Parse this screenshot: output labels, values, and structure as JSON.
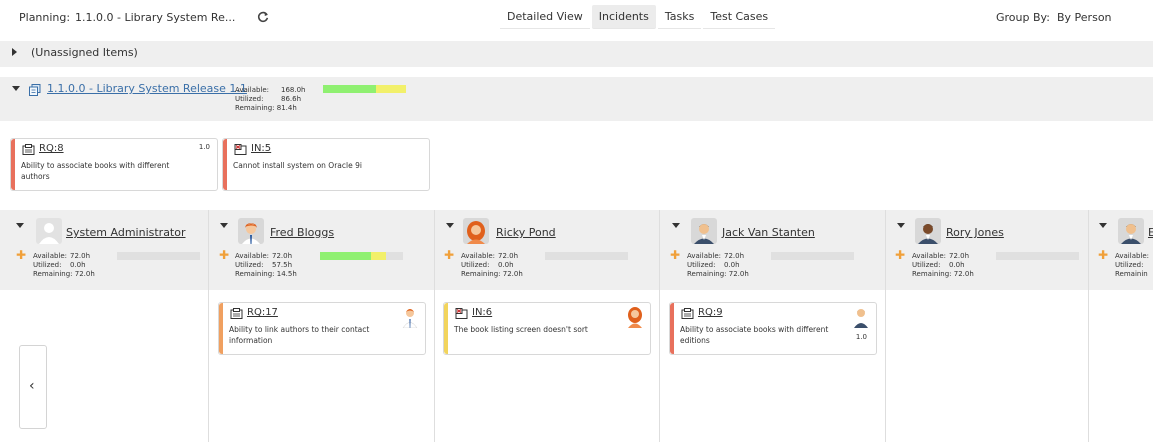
{
  "toolbar": {
    "planning_label": "Planning:",
    "planning_value": "1.1.0.0 - Library System Re...",
    "tabs": [
      "Detailed View",
      "Incidents",
      "Tasks",
      "Test Cases"
    ],
    "active_tab": "Incidents",
    "groupby_label": "Group By:",
    "groupby_value": "By Person"
  },
  "unassigned": {
    "label": "(Unassigned Items)"
  },
  "release": {
    "name": "1.1.0.0 - Library System Release 1.1",
    "available": "Available:",
    "available_val": "168.0h",
    "utilized": "Utilized:",
    "utilized_val": "86.6h",
    "remaining": "Remaining:",
    "remaining_val": "81.4h",
    "bar_green": 0.64,
    "bar_yellow": 0.36
  },
  "release_cards": [
    {
      "id": "RQ:8",
      "desc_1": "Ability to associate books with different",
      "desc_2": "authors",
      "estimate": "1.0",
      "stripe": "#e8705c",
      "icon": "requirement-icon"
    },
    {
      "id": "IN:5",
      "desc_1": "Cannot install system on Oracle 9i",
      "desc_2": "",
      "estimate": "",
      "stripe": "#e8705c",
      "icon": "incident-icon"
    }
  ],
  "people": [
    {
      "name": "System Administrator",
      "available_val": "72.0h",
      "utilized_val": "0.0h",
      "remaining_val": "72.0h",
      "avatar": "default",
      "bar_green": 0,
      "bar_yellow": 0
    },
    {
      "name": "Fred Bloggs",
      "available_val": "72.0h",
      "utilized_val": "57.5h",
      "remaining_val": "14.5h",
      "avatar": "orange-hair",
      "bar_green": 0.62,
      "bar_yellow": 0.18
    },
    {
      "name": "Ricky Pond",
      "available_val": "72.0h",
      "utilized_val": "0.0h",
      "remaining_val": "72.0h",
      "avatar": "red-hair",
      "bar_green": 0,
      "bar_yellow": 0
    },
    {
      "name": "Jack Van Stanten",
      "available_val": "72.0h",
      "utilized_val": "0.0h",
      "remaining_val": "72.0h",
      "avatar": "suit",
      "bar_green": 0,
      "bar_yellow": 0
    },
    {
      "name": "Rory Jones",
      "available_val": "72.0h",
      "utilized_val": "0.0h",
      "remaining_val": "72.0h",
      "avatar": "dark-skin",
      "bar_green": 0,
      "bar_yellow": 0
    },
    {
      "name": "",
      "available_val": "",
      "utilized_val": "",
      "remaining_val": "",
      "avatar": "suit",
      "bar_green": 0,
      "bar_yellow": 0
    }
  ],
  "labels": {
    "available": "Available:",
    "utilized": "Utilized:",
    "remaining": "Remaining:",
    "remaining_cut": "Remainin",
    "available_cut": "Available:"
  },
  "person_cards": [
    {
      "id": "RQ:17",
      "desc_1": "Ability to link authors to their contact",
      "desc_2": "information",
      "estimate": "",
      "stripe": "#f0a060",
      "icon": "requirement-icon"
    },
    {
      "id": "IN:6",
      "desc_1": "The book listing screen doesn't sort",
      "desc_2": "",
      "estimate": "",
      "stripe": "#f2d45c",
      "icon": "incident-icon"
    },
    {
      "id": "RQ:9",
      "desc_1": "Ability to associate books with different",
      "desc_2": "editions",
      "estimate": "1.0",
      "stripe": "#e8705c",
      "icon": "requirement-icon"
    }
  ],
  "nav": {
    "prev_glyph": "‹"
  }
}
